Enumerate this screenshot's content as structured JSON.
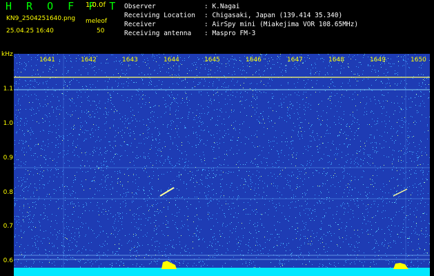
{
  "header": {
    "logo": "H R O F F T",
    "version": "1.0.0f",
    "filename": "KN9_2504251640.png",
    "mode": "meleof",
    "datetime": "25.04.25 16:40",
    "count": "50"
  },
  "info": [
    {
      "label": "Observer",
      "value": "K.Nagai"
    },
    {
      "label": "Receiving Location",
      "value": "Chigasaki, Japan (139.414 35.340)"
    },
    {
      "label": "Receiver",
      "value": "AirSpy mini (Miakejima VOR 108.65MHz)"
    },
    {
      "label": "Receiving antenna",
      "value": "Maspro FM-3"
    }
  ],
  "axes": {
    "y_unit": "kHz",
    "y_ticks": [
      "1.1",
      "1.0",
      "0.9",
      "0.8",
      "0.7",
      "0.6"
    ],
    "x_ticks": [
      "1641",
      "1642",
      "1643",
      "1644",
      "1645",
      "1646",
      "1647",
      "1648",
      "1649",
      "1650"
    ]
  },
  "colors": {
    "background": "#1e3cb4",
    "noise": "#3aa0ff",
    "carrier": "#9af0ff",
    "bright": "#ffff66",
    "cyan_band": "#00e8ff",
    "labels": "#ffff00"
  }
}
